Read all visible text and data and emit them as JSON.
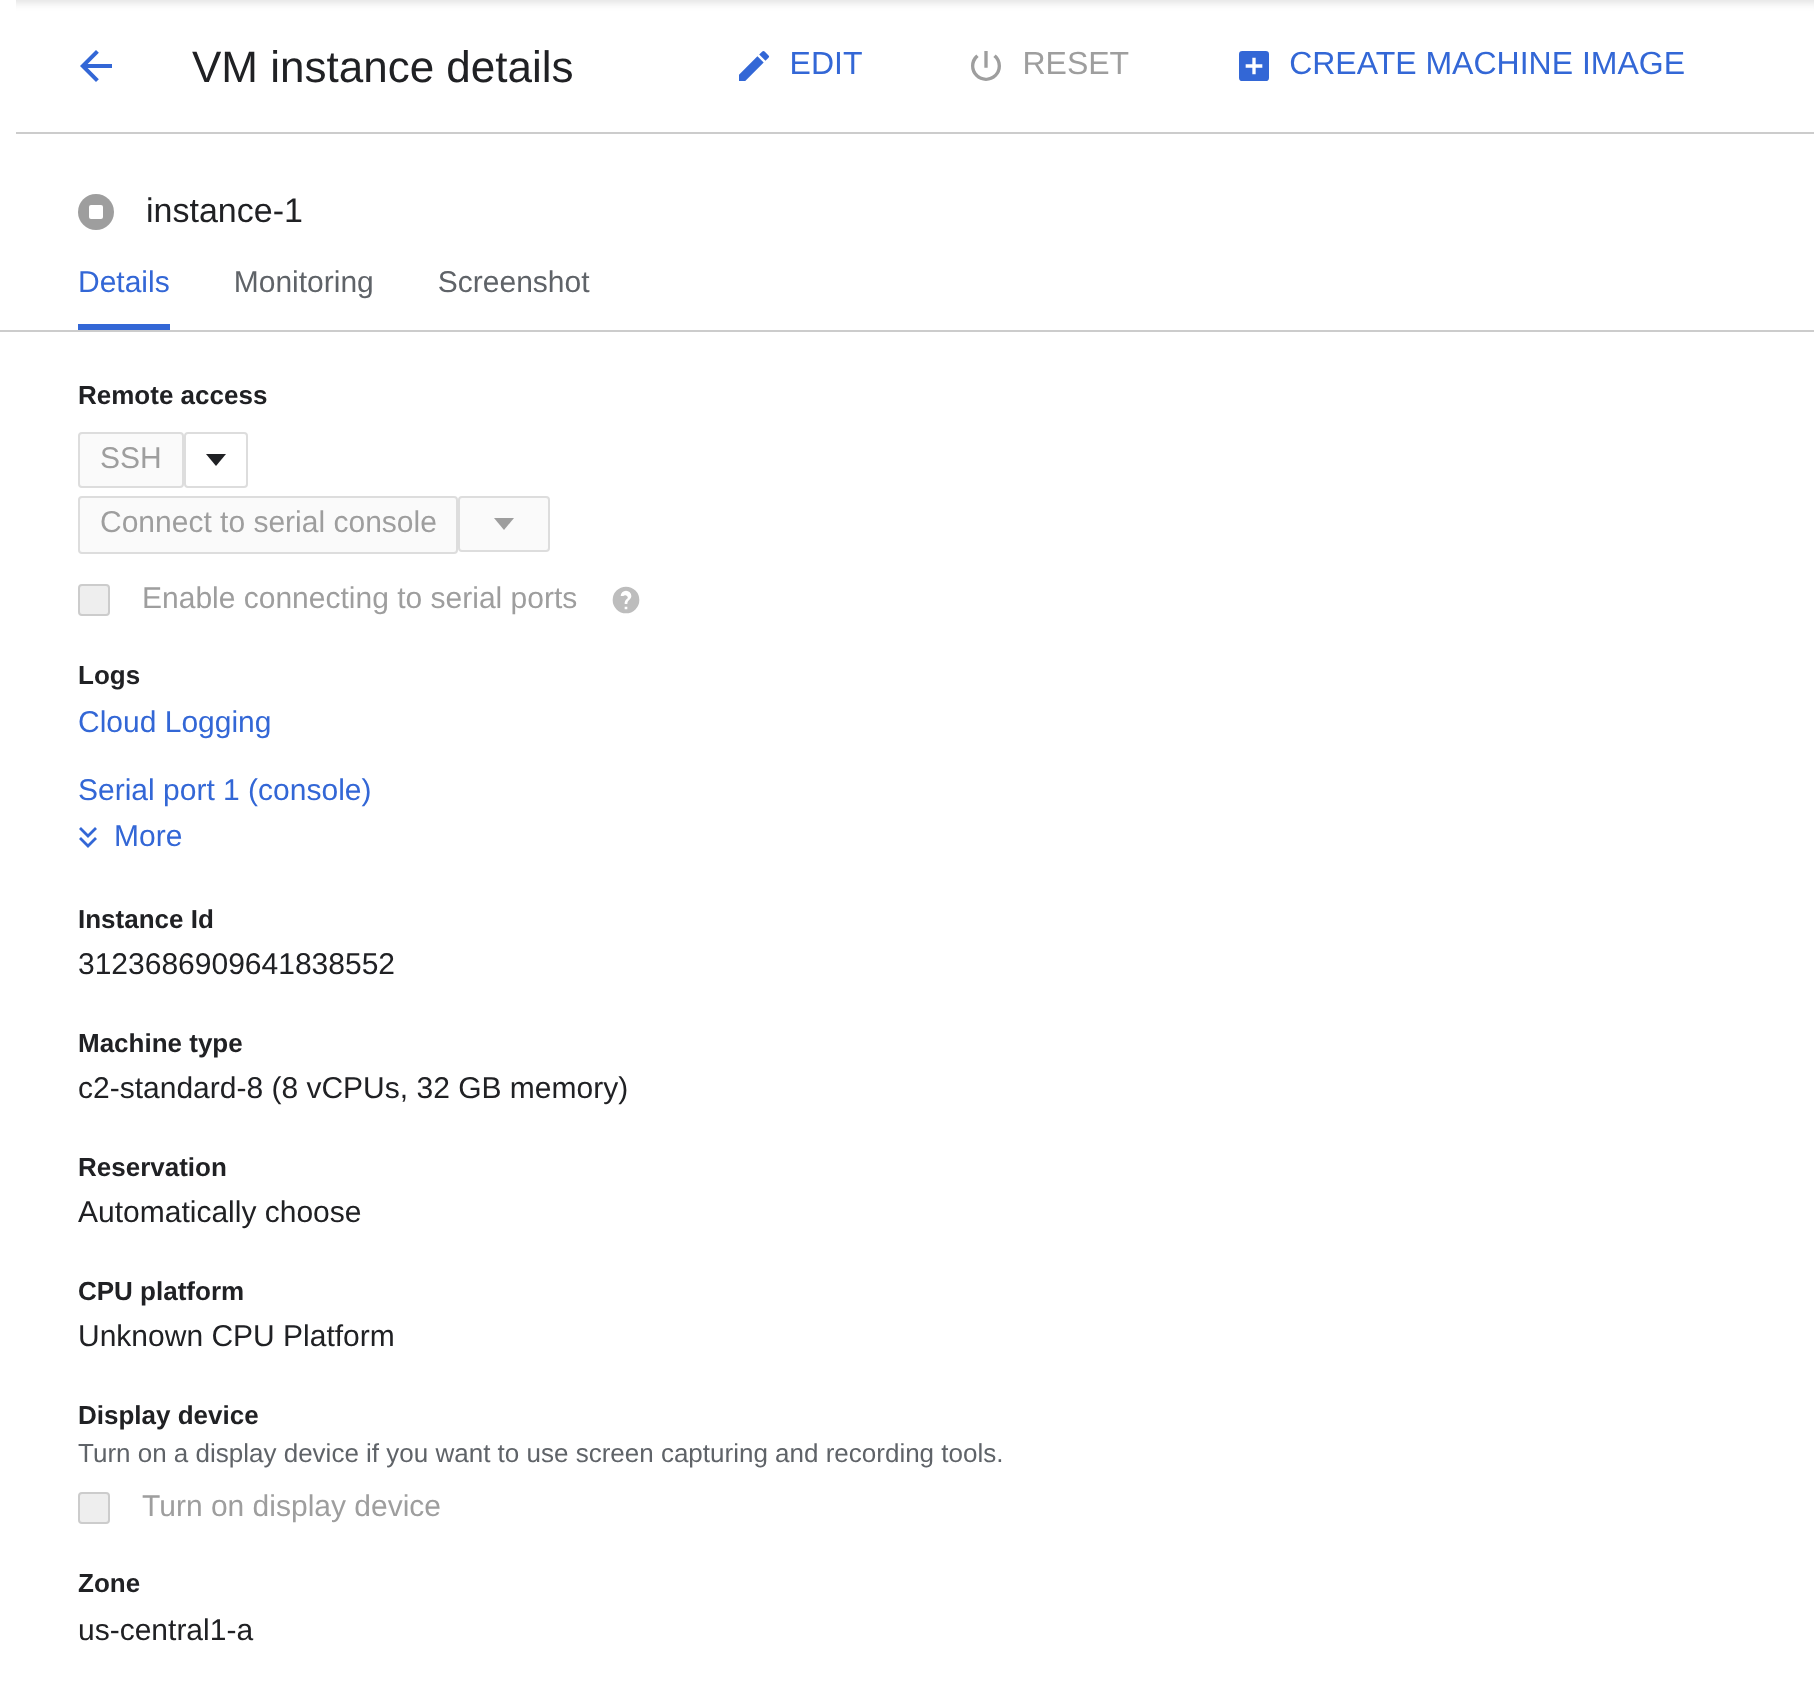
{
  "header": {
    "title": "VM instance details",
    "actions": [
      {
        "label": "EDIT",
        "kind": "edit",
        "disabled": false
      },
      {
        "label": "RESET",
        "kind": "reset",
        "disabled": true
      },
      {
        "label": "CREATE MACHINE IMAGE",
        "kind": "create",
        "disabled": false
      }
    ]
  },
  "instance": {
    "name": "instance-1"
  },
  "tabs": [
    {
      "label": "Details",
      "selected": true
    },
    {
      "label": "Monitoring",
      "selected": false
    },
    {
      "label": "Screenshot",
      "selected": false
    }
  ],
  "sections": [
    {
      "kind": "remote",
      "label": "Remote access",
      "ssh_button": "SSH",
      "serial_button": "Connect to serial console",
      "checkbox": {
        "label": "Enable connecting to serial ports",
        "checked": false,
        "disabled": true
      }
    },
    {
      "kind": "links",
      "label": "Logs",
      "links": [
        "Cloud Logging",
        "Serial port 1 (console)"
      ],
      "more": "More"
    },
    {
      "kind": "value",
      "label": "Instance Id",
      "value": "3123686909641838552"
    },
    {
      "kind": "value",
      "label": "Machine type",
      "value": "c2-standard-8 (8 vCPUs, 32 GB memory)"
    },
    {
      "kind": "value",
      "label": "Reservation",
      "value": "Automatically choose"
    },
    {
      "kind": "value",
      "label": "CPU platform",
      "value": "Unknown CPU Platform"
    },
    {
      "kind": "option",
      "label": "Display device",
      "description": "Turn on a display device if you want to use screen capturing and recording tools.",
      "checkbox": {
        "label": "Turn on display device",
        "checked": false,
        "disabled": true
      }
    },
    {
      "kind": "value",
      "label": "Zone",
      "value": "us-central1-a"
    }
  ]
}
